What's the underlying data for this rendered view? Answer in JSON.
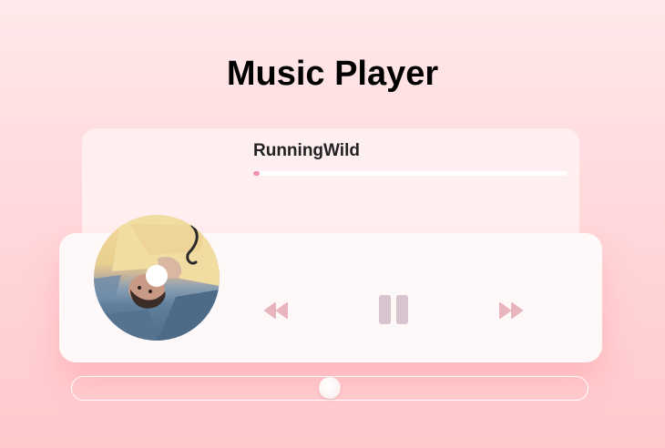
{
  "header": {
    "title": "Music Player"
  },
  "track": {
    "name": "RunningWild",
    "progress_fraction": 0.02
  },
  "controls": {
    "previous_icon": "rewind-icon",
    "pause_icon": "pause-icon",
    "next_icon": "fast-forward-icon"
  },
  "volume": {
    "fraction": 0.5
  },
  "colors": {
    "accent": "#f48fb1",
    "control": "#d7c4cf",
    "skip_control": "#e9b5bd"
  }
}
